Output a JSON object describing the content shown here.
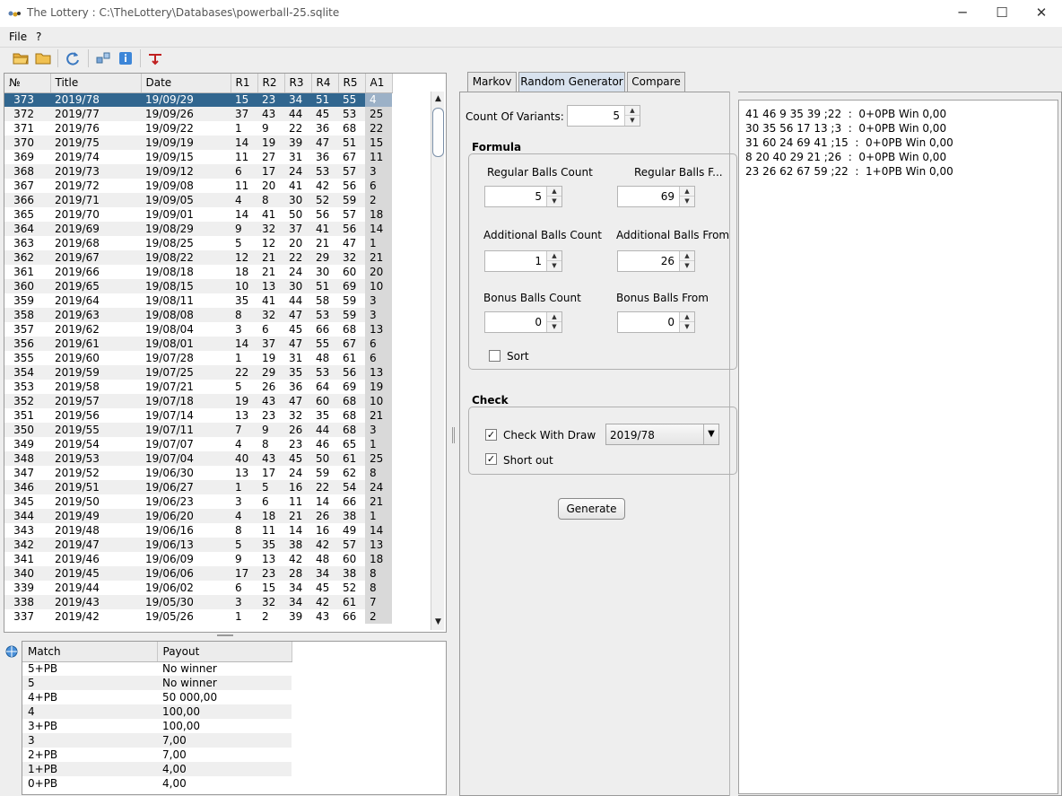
{
  "window": {
    "title": "The Lottery : C:\\TheLottery\\Databases\\powerball-25.sqlite",
    "minimize": "─",
    "maximize": "☐",
    "close": "✕"
  },
  "menu": {
    "file": "File",
    "help": "?"
  },
  "draws_table": {
    "columns": [
      "№",
      "Title",
      "Date",
      "R1",
      "R2",
      "R3",
      "R4",
      "R5",
      "A1"
    ],
    "rows": [
      [
        "373",
        "2019/78",
        "19/09/29",
        "15",
        "23",
        "34",
        "51",
        "55",
        "4"
      ],
      [
        "372",
        "2019/77",
        "19/09/26",
        "37",
        "43",
        "44",
        "45",
        "53",
        "25"
      ],
      [
        "371",
        "2019/76",
        "19/09/22",
        "1",
        "9",
        "22",
        "36",
        "68",
        "22"
      ],
      [
        "370",
        "2019/75",
        "19/09/19",
        "14",
        "19",
        "39",
        "47",
        "51",
        "15"
      ],
      [
        "369",
        "2019/74",
        "19/09/15",
        "11",
        "27",
        "31",
        "36",
        "67",
        "11"
      ],
      [
        "368",
        "2019/73",
        "19/09/12",
        "6",
        "17",
        "24",
        "53",
        "57",
        "3"
      ],
      [
        "367",
        "2019/72",
        "19/09/08",
        "11",
        "20",
        "41",
        "42",
        "56",
        "6"
      ],
      [
        "366",
        "2019/71",
        "19/09/05",
        "4",
        "8",
        "30",
        "52",
        "59",
        "2"
      ],
      [
        "365",
        "2019/70",
        "19/09/01",
        "14",
        "41",
        "50",
        "56",
        "57",
        "18"
      ],
      [
        "364",
        "2019/69",
        "19/08/29",
        "9",
        "32",
        "37",
        "41",
        "56",
        "14"
      ],
      [
        "363",
        "2019/68",
        "19/08/25",
        "5",
        "12",
        "20",
        "21",
        "47",
        "1"
      ],
      [
        "362",
        "2019/67",
        "19/08/22",
        "12",
        "21",
        "22",
        "29",
        "32",
        "21"
      ],
      [
        "361",
        "2019/66",
        "19/08/18",
        "18",
        "21",
        "24",
        "30",
        "60",
        "20"
      ],
      [
        "360",
        "2019/65",
        "19/08/15",
        "10",
        "13",
        "30",
        "51",
        "69",
        "10"
      ],
      [
        "359",
        "2019/64",
        "19/08/11",
        "35",
        "41",
        "44",
        "58",
        "59",
        "3"
      ],
      [
        "358",
        "2019/63",
        "19/08/08",
        "8",
        "32",
        "47",
        "53",
        "59",
        "3"
      ],
      [
        "357",
        "2019/62",
        "19/08/04",
        "3",
        "6",
        "45",
        "66",
        "68",
        "13"
      ],
      [
        "356",
        "2019/61",
        "19/08/01",
        "14",
        "37",
        "47",
        "55",
        "67",
        "6"
      ],
      [
        "355",
        "2019/60",
        "19/07/28",
        "1",
        "19",
        "31",
        "48",
        "61",
        "6"
      ],
      [
        "354",
        "2019/59",
        "19/07/25",
        "22",
        "29",
        "35",
        "53",
        "56",
        "13"
      ],
      [
        "353",
        "2019/58",
        "19/07/21",
        "5",
        "26",
        "36",
        "64",
        "69",
        "19"
      ],
      [
        "352",
        "2019/57",
        "19/07/18",
        "19",
        "43",
        "47",
        "60",
        "68",
        "10"
      ],
      [
        "351",
        "2019/56",
        "19/07/14",
        "13",
        "23",
        "32",
        "35",
        "68",
        "21"
      ],
      [
        "350",
        "2019/55",
        "19/07/11",
        "7",
        "9",
        "26",
        "44",
        "68",
        "3"
      ],
      [
        "349",
        "2019/54",
        "19/07/07",
        "4",
        "8",
        "23",
        "46",
        "65",
        "1"
      ],
      [
        "348",
        "2019/53",
        "19/07/04",
        "40",
        "43",
        "45",
        "50",
        "61",
        "25"
      ],
      [
        "347",
        "2019/52",
        "19/06/30",
        "13",
        "17",
        "24",
        "59",
        "62",
        "8"
      ],
      [
        "346",
        "2019/51",
        "19/06/27",
        "1",
        "5",
        "16",
        "22",
        "54",
        "24"
      ],
      [
        "345",
        "2019/50",
        "19/06/23",
        "3",
        "6",
        "11",
        "14",
        "66",
        "21"
      ],
      [
        "344",
        "2019/49",
        "19/06/20",
        "4",
        "18",
        "21",
        "26",
        "38",
        "1"
      ],
      [
        "343",
        "2019/48",
        "19/06/16",
        "8",
        "11",
        "14",
        "16",
        "49",
        "14"
      ],
      [
        "342",
        "2019/47",
        "19/06/13",
        "5",
        "35",
        "38",
        "42",
        "57",
        "13"
      ],
      [
        "341",
        "2019/46",
        "19/06/09",
        "9",
        "13",
        "42",
        "48",
        "60",
        "18"
      ],
      [
        "340",
        "2019/45",
        "19/06/06",
        "17",
        "23",
        "28",
        "34",
        "38",
        "8"
      ],
      [
        "339",
        "2019/44",
        "19/06/02",
        "6",
        "15",
        "34",
        "45",
        "52",
        "8"
      ],
      [
        "338",
        "2019/43",
        "19/05/30",
        "3",
        "32",
        "34",
        "42",
        "61",
        "7"
      ],
      [
        "337",
        "2019/42",
        "19/05/26",
        "1",
        "2",
        "39",
        "43",
        "66",
        "2"
      ]
    ]
  },
  "payout_table": {
    "columns": [
      "Match",
      "Payout"
    ],
    "rows": [
      [
        "5+PB",
        "No winner"
      ],
      [
        "5",
        "No winner"
      ],
      [
        "4+PB",
        "50 000,00"
      ],
      [
        "4",
        "100,00"
      ],
      [
        "3+PB",
        "100,00"
      ],
      [
        "3",
        "7,00"
      ],
      [
        "2+PB",
        "7,00"
      ],
      [
        "1+PB",
        "4,00"
      ],
      [
        "0+PB",
        "4,00"
      ]
    ]
  },
  "tabs": [
    "Markov",
    "Random Generator",
    "Compare"
  ],
  "generator": {
    "count_label": "Count Of Variants:",
    "count_value": "5",
    "formula_title": "Formula",
    "regular_count_label": "Regular Balls Count",
    "regular_count": "5",
    "regular_from_label": "Regular Balls F...",
    "regular_from": "69",
    "additional_count_label": "Additional Balls Count",
    "additional_count": "1",
    "additional_from_label": "Additional Balls From",
    "additional_from": "26",
    "bonus_count_label": "Bonus Balls Count",
    "bonus_count": "0",
    "bonus_from_label": "Bonus Balls From",
    "bonus_from": "0",
    "sort_label": "Sort",
    "check_title": "Check",
    "check_with_draw_label": "Check With Draw",
    "draw_value": "2019/78",
    "short_out_label": "Short out",
    "generate_label": "Generate"
  },
  "results": [
    "41 46 9 35 39 ;22  :  0+0PB Win 0,00",
    "30 35 56 17 13 ;3  :  0+0PB Win 0,00",
    "31 60 24 69 41 ;15  :  0+0PB Win 0,00",
    "8 20 40 29 21 ;26  :  0+0PB Win 0,00",
    "23 26 62 67 59 ;22  :  1+0PB Win 0,00"
  ]
}
